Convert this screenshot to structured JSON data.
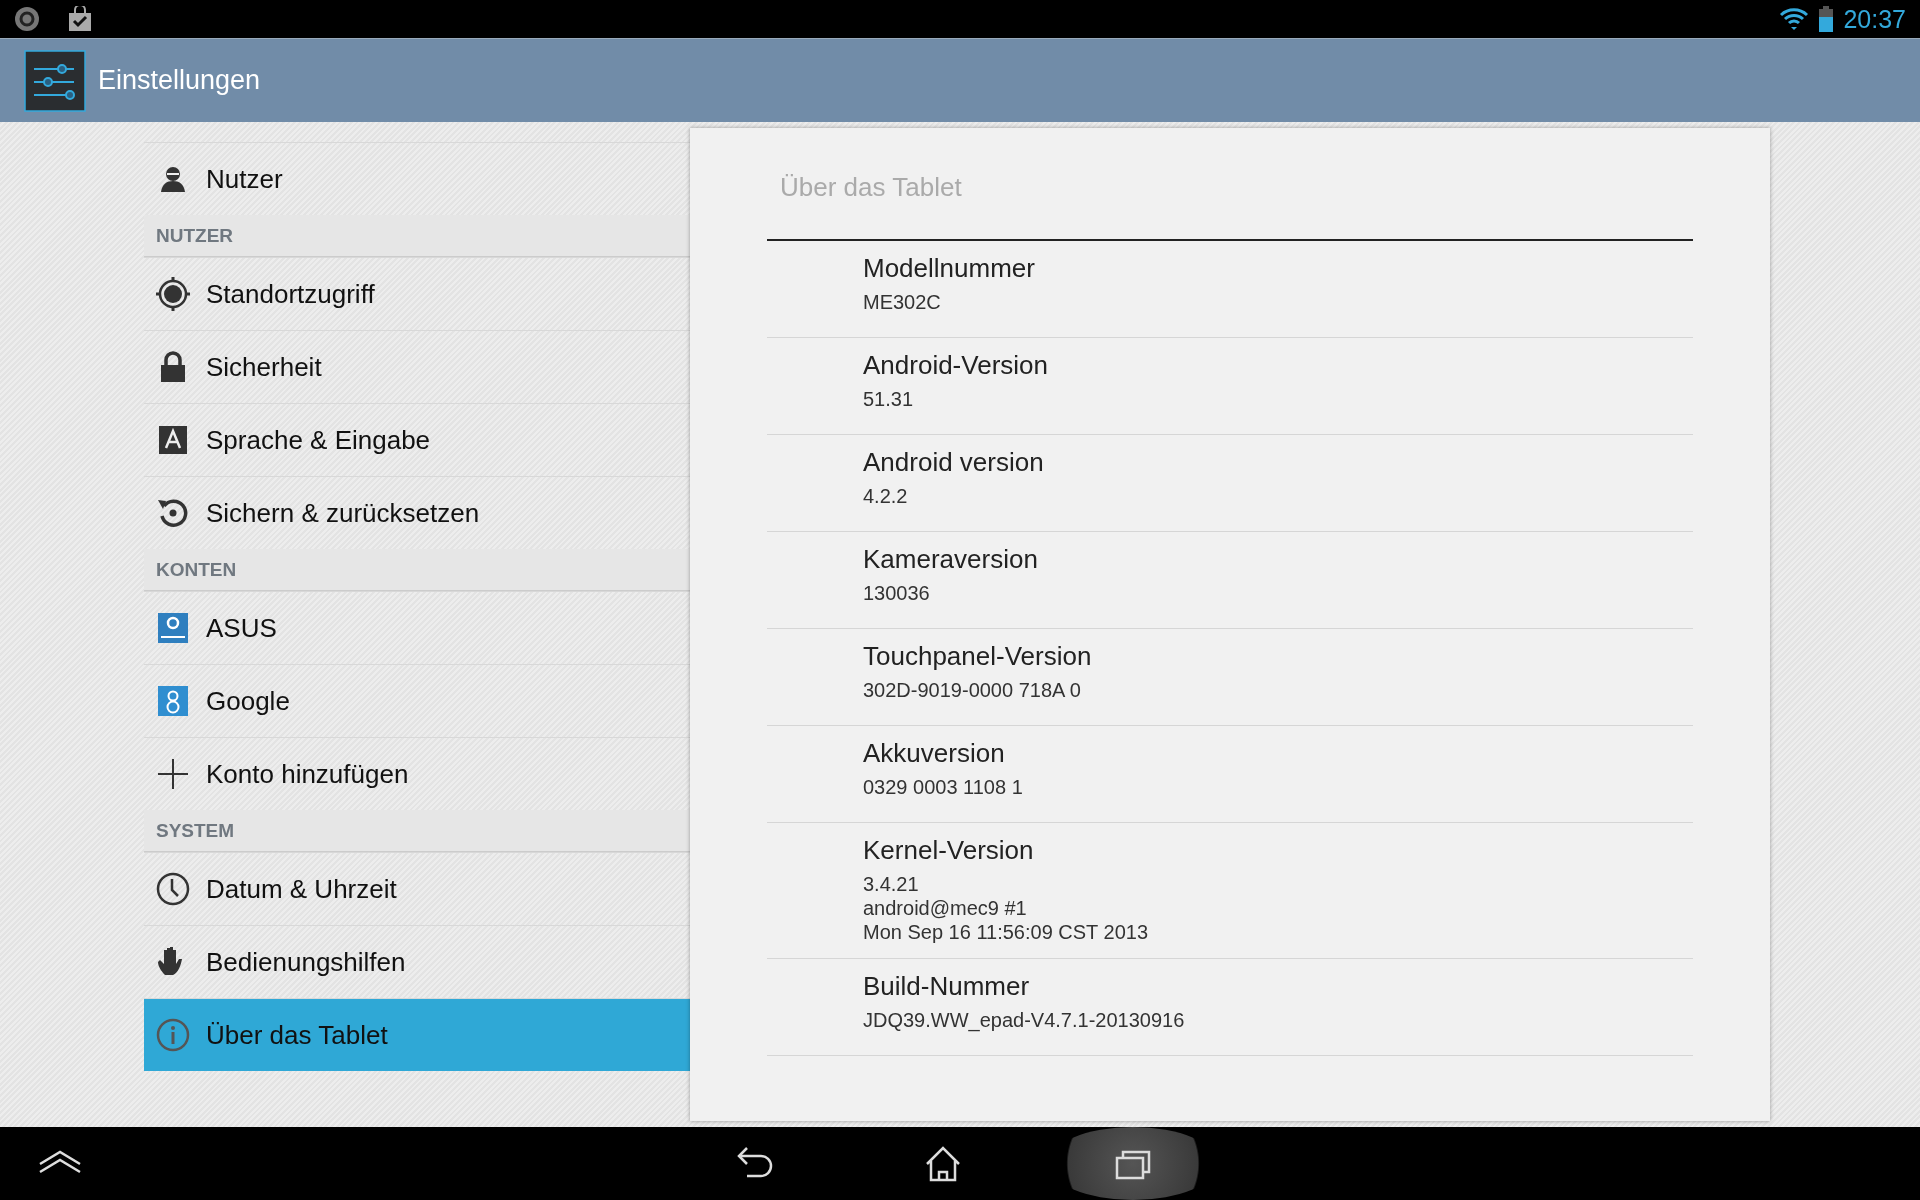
{
  "status_bar": {
    "time": "20:37"
  },
  "action_bar": {
    "title": "Einstellungen"
  },
  "sidebar": {
    "items": [
      {
        "kind": "item",
        "label": "Nutzer",
        "selected": false
      },
      {
        "kind": "header",
        "label": "NUTZER"
      },
      {
        "kind": "item",
        "label": "Standortzugriff",
        "selected": false
      },
      {
        "kind": "item",
        "label": "Sicherheit",
        "selected": false
      },
      {
        "kind": "item",
        "label": "Sprache & Eingabe",
        "selected": false
      },
      {
        "kind": "item",
        "label": "Sichern & zurücksetzen",
        "selected": false
      },
      {
        "kind": "header",
        "label": "KONTEN"
      },
      {
        "kind": "item",
        "label": "ASUS",
        "selected": false
      },
      {
        "kind": "item",
        "label": "Google",
        "selected": false
      },
      {
        "kind": "item",
        "label": "Konto hinzufügen",
        "selected": false
      },
      {
        "kind": "header",
        "label": "SYSTEM"
      },
      {
        "kind": "item",
        "label": "Datum & Uhrzeit",
        "selected": false
      },
      {
        "kind": "item",
        "label": "Bedienungshilfen",
        "selected": false
      },
      {
        "kind": "item",
        "label": "Über das Tablet",
        "selected": true
      }
    ]
  },
  "detail": {
    "title": "Über das Tablet",
    "items": [
      {
        "title": "Modellnummer",
        "summary": [
          "ME302C"
        ]
      },
      {
        "title": "Android-Version",
        "summary": [
          "51.31"
        ]
      },
      {
        "title": "Android version",
        "summary": [
          "4.2.2"
        ]
      },
      {
        "title": "Kameraversion",
        "summary": [
          "130036"
        ]
      },
      {
        "title": "Touchpanel-Version",
        "summary": [
          "302D-9019-0000 718A 0"
        ]
      },
      {
        "title": "Akkuversion",
        "summary": [
          "0329 0003 1108 1"
        ]
      },
      {
        "title": "Kernel-Version",
        "summary": [
          "3.4.21",
          "android@mec9 #1",
          "Mon Sep 16 11:56:09 CST 2013"
        ]
      },
      {
        "title": "Build-Nummer",
        "summary": [
          "JDQ39.WW_epad-V4.7.1-20130916"
        ]
      }
    ]
  },
  "nav_bar": {
    "buttons": [
      {
        "pressed": false
      },
      {
        "pressed": false
      },
      {
        "pressed": false
      },
      {
        "pressed": true
      }
    ]
  }
}
